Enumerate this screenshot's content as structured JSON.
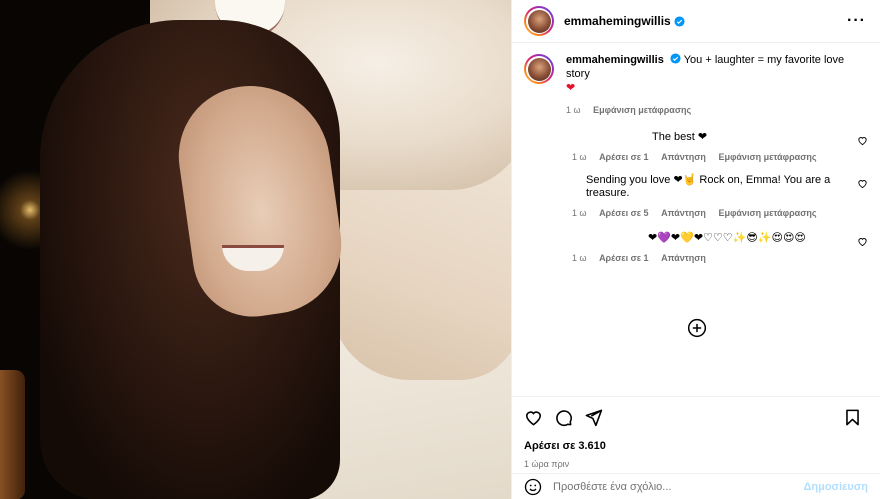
{
  "post": {
    "username": "emmahemingwillis",
    "caption_text": "You + laughter = my favorite love story",
    "caption_emoji": "❤",
    "caption_time": "1 ω",
    "see_translation": "Εμφάνιση μετάφρασης"
  },
  "comments": [
    {
      "text": "The best ❤",
      "time": "1 ω",
      "likes": "Αρέσει σε 1",
      "reply": "Απάντηση",
      "translation": "Εμφάνιση μετάφρασης"
    },
    {
      "text": "Sending you love ❤🤘 Rock on, Emma! You are a treasure.",
      "time": "1 ω",
      "likes": "Αρέσει σε 5",
      "reply": "Απάντηση",
      "translation": "Εμφάνιση μετάφρασης"
    },
    {
      "text": "❤💜❤💛❤♡♡♡✨😎✨😍😍😍",
      "time": "1 ω",
      "likes": "Αρέσει σε 1",
      "reply": "Απάντηση"
    }
  ],
  "footer": {
    "likes": "Αρέσει σε 3.610",
    "time": "1 ώρα πριν",
    "add_comment_placeholder": "Προσθέστε ένα σχόλιο...",
    "post_button": "Δημοσίευση"
  },
  "colors": {
    "accent_blue": "#0095f6",
    "heart_red": "#e0162b",
    "meta_grey": "#737373"
  }
}
